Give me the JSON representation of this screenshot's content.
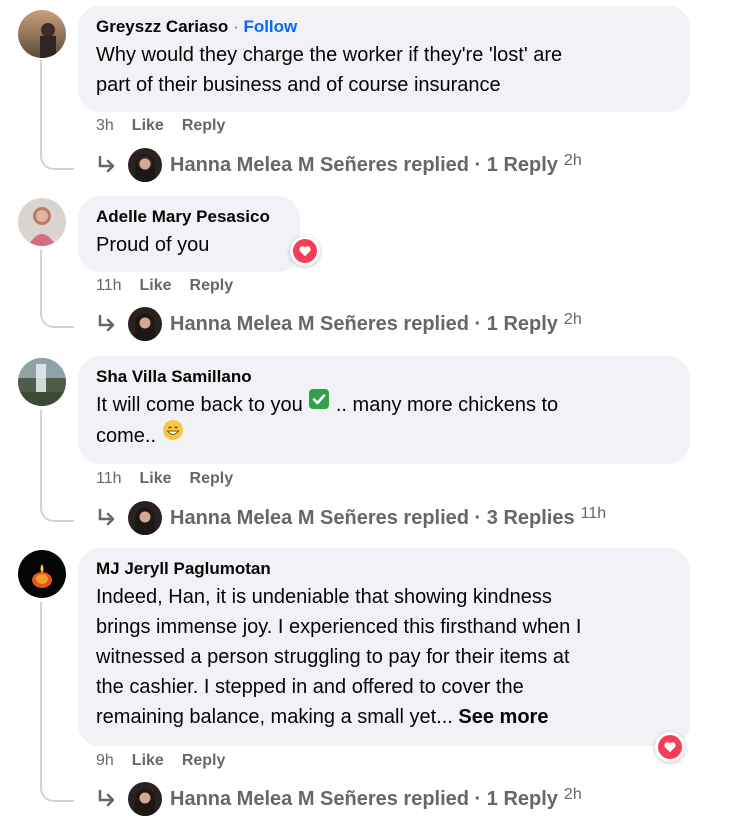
{
  "comments": [
    {
      "author": "Greyszz Cariaso",
      "follow": "Follow",
      "text_lines": [
        "Why would they charge the worker if they're 'lost' are",
        "part of their business and of course insurance"
      ],
      "time": "3h",
      "like": "Like",
      "reply": "Reply",
      "replies_summary": "Hanna Melea M Señeres replied · 1 Reply",
      "replies_time": "2h"
    },
    {
      "author": "Adelle Mary Pesasico",
      "text_lines": [
        "Proud of you"
      ],
      "time": "11h",
      "like": "Like",
      "reply": "Reply",
      "reaction": "heart",
      "replies_summary": "Hanna Melea M Señeres replied · 1 Reply",
      "replies_time": "2h"
    },
    {
      "author": "Sha Villa Samillano",
      "text_line1_a": "It will come back to you",
      "text_line1_emoji": "check-mark-emoji",
      "text_line1_b": ".. many more chickens to",
      "text_line2": "come..",
      "text_line2_emoji": "grinning-emoji",
      "time": "11h",
      "like": "Like",
      "reply": "Reply",
      "replies_summary": "Hanna Melea M Señeres replied · 3 Replies",
      "replies_time": "11h"
    },
    {
      "author": "MJ Jeryll Paglumotan",
      "text_lines": [
        "Indeed, Han, it is undeniable that showing kindness",
        "brings immense joy. I experienced this firsthand when I",
        "witnessed a person struggling to pay for their items at",
        "the cashier. I stepped in and offered to cover the"
      ],
      "text_last": "remaining balance, making a small yet...",
      "see_more": "See more",
      "time": "9h",
      "like": "Like",
      "reply": "Reply",
      "reaction": "heart",
      "replies_summary": "Hanna Melea M Señeres replied · 1 Reply",
      "replies_time": "2h"
    }
  ],
  "colors": {
    "bubble": "#f0f2f5",
    "follow": "#0866ff",
    "secondary_text": "#65676b",
    "heart": "#f33e58",
    "check": "#31a24c"
  }
}
